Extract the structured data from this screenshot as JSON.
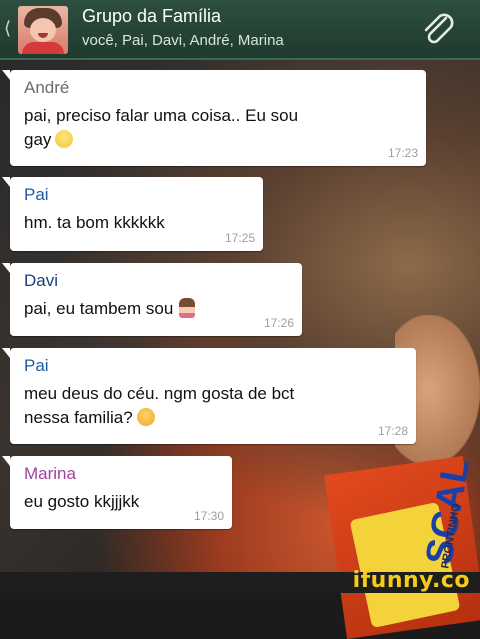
{
  "header": {
    "back_glyph": "⟨",
    "title": "Grupo da Família",
    "subtitle": "você, Pai, Davi, André, Marina"
  },
  "colors": {
    "header_bg": "#2d4f3f",
    "bubble_bg": "#ffffff",
    "andre": "#6b6b6b",
    "pai": "#1f5aa6",
    "davi": "#1a3f7a",
    "marina": "#a0449b",
    "timestamp": "#9aa0a3",
    "ifunny": "#f6cc1b"
  },
  "messages": [
    {
      "sender": "André",
      "text_before": "pai, preciso falar uma coisa.. Eu sou",
      "text_after": "gay",
      "emoji": "smile-icon",
      "time": "17:23"
    },
    {
      "sender": "Pai",
      "text": "hm. ta bom kkkkkk",
      "time": "17:25"
    },
    {
      "sender": "Davi",
      "text": "pai, eu tambem sou",
      "emoji": "girl-icon",
      "time": "17:26"
    },
    {
      "sender": "Pai",
      "text_before": "meu deus do céu. ngm gosta de bct",
      "text_after": "nessa familia?",
      "emoji": "angry-icon",
      "time": "17:28"
    },
    {
      "sender": "Marina",
      "text": "eu gosto kkjjjkk",
      "time": "17:30"
    }
  ],
  "background": {
    "box_text": "SCAL",
    "box_sub": "PRONTINHO"
  },
  "footer": {
    "watermark": "ifunny.co"
  },
  "icons": [
    "back-icon",
    "group-avatar",
    "attach-clip-icon"
  ]
}
